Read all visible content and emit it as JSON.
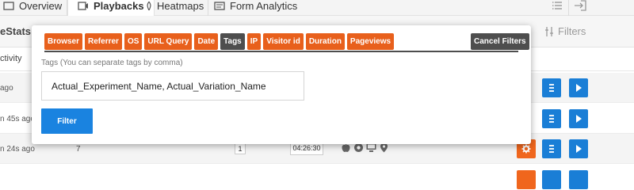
{
  "nav": {
    "tabs": [
      {
        "label": "Overview",
        "icon": "overview-icon"
      },
      {
        "label": "Playbacks",
        "icon": "playbacks-icon",
        "active": true
      },
      {
        "label": "Heatmaps",
        "icon": "heatmaps-icon"
      },
      {
        "label": "Form Analytics",
        "icon": "form-analytics-icon"
      }
    ],
    "right_icons": [
      "list-icon",
      "export-icon"
    ]
  },
  "subheader": {
    "title_partial": "eStats V",
    "filters_label": "Filters"
  },
  "columns": {
    "activity_partial": "ctivity"
  },
  "rows": [
    {
      "time_partial": "ago",
      "num": "",
      "badge": "",
      "duration": ""
    },
    {
      "time_partial": "n 45s ago",
      "num": "",
      "badge": "",
      "duration": ""
    },
    {
      "time_partial": "n 24s ago",
      "num": "7",
      "badge": "1",
      "duration": "04:26:30"
    }
  ],
  "filter_panel": {
    "tabs": [
      "Browser",
      "Referrer",
      "OS",
      "URL Query",
      "Date",
      "Tags",
      "IP",
      "Visitor id",
      "Duration",
      "Pageviews"
    ],
    "selected_tab": "Tags",
    "cancel_label": "Cancel Filters",
    "tags_label": "Tags (You can separate tags by comma)",
    "tags_value": "Actual_Experiment_Name, Actual_Variation_Name",
    "filter_button_label": "Filter"
  },
  "colors": {
    "orange": "#e8601c",
    "dark": "#4e4e4e",
    "blue": "#1a83e0"
  }
}
